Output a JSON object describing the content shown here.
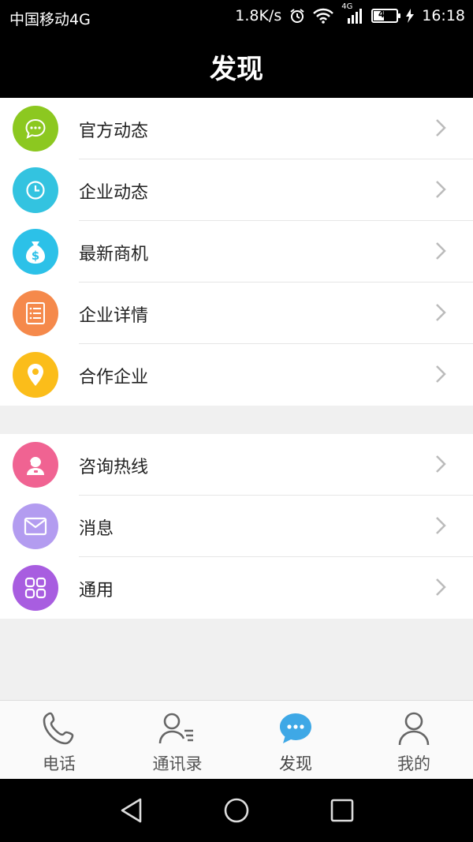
{
  "status_bar": {
    "carrier": "中国移动4G",
    "speed": "1.8K/s",
    "network": "4G",
    "battery": "41",
    "time": "16:18"
  },
  "header": {
    "title": "发现"
  },
  "group1": [
    {
      "label": "官方动态",
      "icon": "chat-bubble-icon",
      "color": "#8cc820"
    },
    {
      "label": "企业动态",
      "icon": "clock-icon",
      "color": "#33c3e0"
    },
    {
      "label": "最新商机",
      "icon": "money-bag-icon",
      "color": "#2cc1e8"
    },
    {
      "label": "企业详情",
      "icon": "document-list-icon",
      "color": "#f5894b"
    },
    {
      "label": "合作企业",
      "icon": "location-pin-icon",
      "color": "#fbbd1a"
    }
  ],
  "group2": [
    {
      "label": "咨询热线",
      "icon": "customer-service-icon",
      "color": "#f06392"
    },
    {
      "label": "消息",
      "icon": "envelope-icon",
      "color": "#b39cf0"
    },
    {
      "label": "通用",
      "icon": "grid-icon",
      "color": "#a85de0"
    }
  ],
  "tabs": [
    {
      "label": "电话",
      "icon": "phone-icon"
    },
    {
      "label": "通讯录",
      "icon": "contacts-icon"
    },
    {
      "label": "发现",
      "icon": "discover-chat-icon",
      "active": true,
      "color": "#3ea8e6"
    },
    {
      "label": "我的",
      "icon": "profile-icon"
    }
  ],
  "nav": {
    "back": "back-icon",
    "home": "home-icon",
    "recent": "recent-apps-icon"
  }
}
